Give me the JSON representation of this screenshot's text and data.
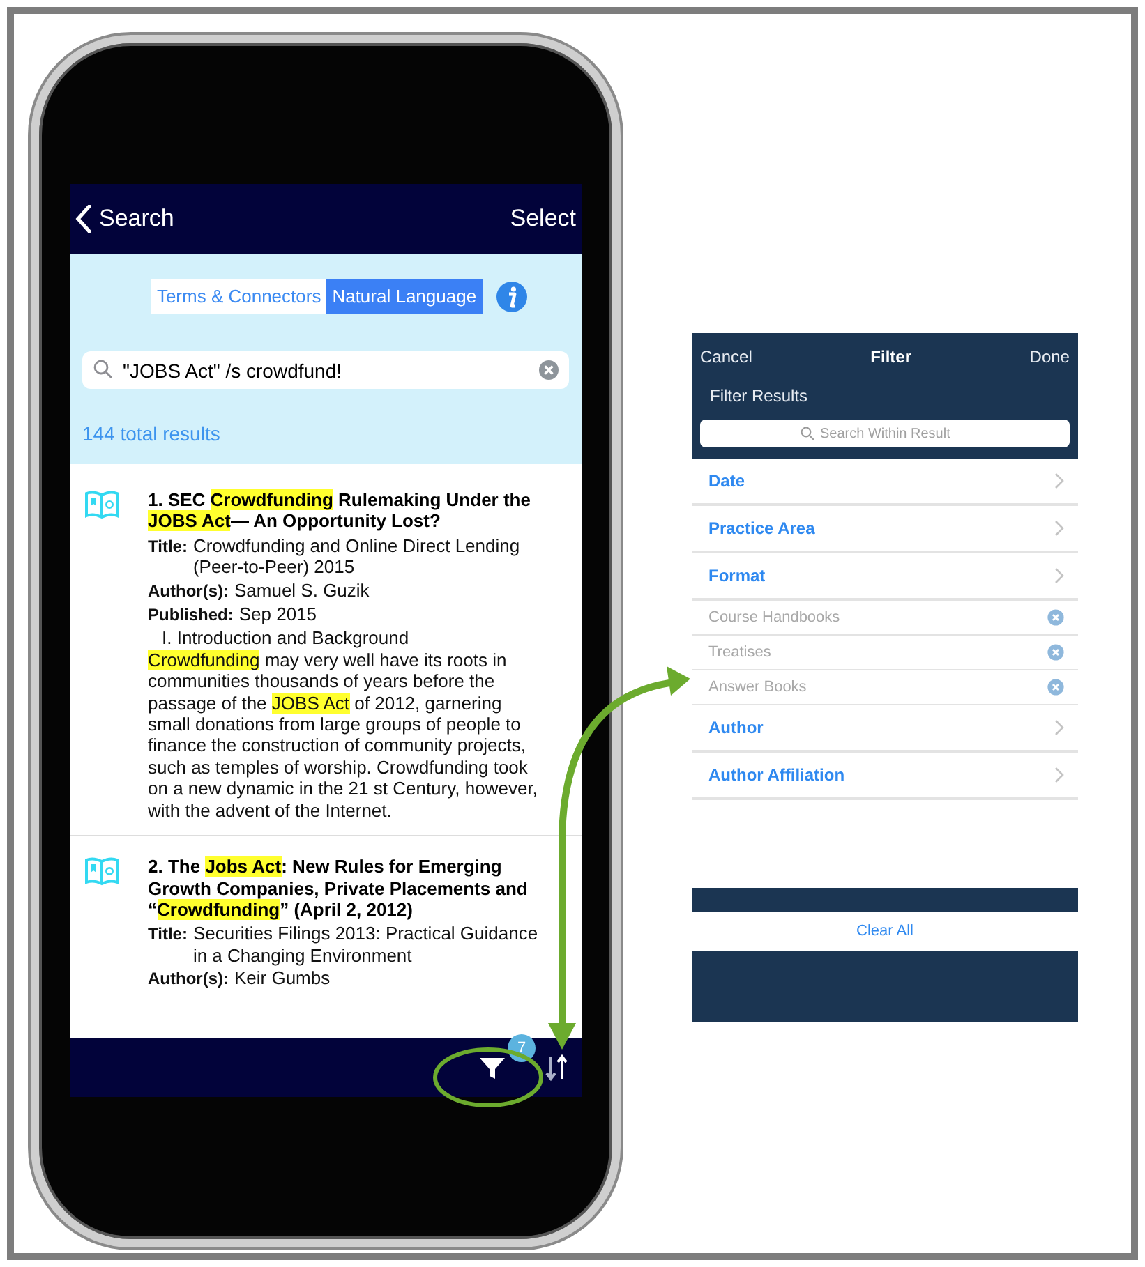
{
  "phone": {
    "nav": {
      "back": "Search",
      "action": "Select"
    },
    "mode_tabs": [
      {
        "label": "Terms & Connectors",
        "selected": false
      },
      {
        "label": "Natural Language",
        "selected": true
      }
    ],
    "search": {
      "value": "\"JOBS Act\" /s crowdfund!"
    },
    "result_count": "144 total results",
    "results": [
      {
        "title": [
          {
            "text": "1. SEC ",
            "highlight": false
          },
          {
            "text": "Crowdfunding",
            "highlight": true
          },
          {
            "text": " Rulemaking Under the ",
            "highlight": false
          },
          {
            "text": "JOBS Act",
            "highlight": true
          },
          {
            "text": "— An Opportunity Lost?",
            "highlight": false
          }
        ],
        "fields": [
          {
            "label": "Title:",
            "value": "Crowdfunding and Online Direct Lending (Peer-to-Peer) 2015"
          },
          {
            "label": "Author(s):",
            "value": "Samuel S. Guzik"
          },
          {
            "label": "Published:",
            "value": "Sep 2015"
          }
        ],
        "snippet_heading": "I. Introduction and Background",
        "snippet": [
          {
            "text": "Crowdfunding",
            "highlight": true
          },
          {
            "text": " may very well have its roots in communities thousands of years before the passage of the ",
            "highlight": false
          },
          {
            "text": "JOBS Act",
            "highlight": true
          },
          {
            "text": " of 2012, garnering small donations from large groups of people to finance the construction of community projects, such as temples of worship. Crowdfunding took on a new dynamic in the 21 st Century, however, with the advent of the Internet.",
            "highlight": false
          }
        ]
      },
      {
        "title": [
          {
            "text": "2. The ",
            "highlight": false
          },
          {
            "text": "Jobs Act",
            "highlight": true
          },
          {
            "text": ": New Rules for Emerging Growth Companies, Private Placements and “",
            "highlight": false
          },
          {
            "text": "Crowdfunding",
            "highlight": true
          },
          {
            "text": "” (April 2, 2012)",
            "highlight": false
          }
        ],
        "fields": [
          {
            "label": "Title:",
            "value": "Securities Filings 2013: Practical Guidance in a Changing Environment"
          },
          {
            "label": "Author(s):",
            "value": "Keir Gumbs"
          }
        ]
      }
    ],
    "toolbar": {
      "filter_count": "7"
    }
  },
  "filter_panel": {
    "cancel": "Cancel",
    "title": "Filter",
    "done": "Done",
    "subtitle": "Filter Results",
    "search": {
      "placeholder": "Search Within Result"
    },
    "rows": [
      {
        "kind": "category",
        "label": "Date"
      },
      {
        "kind": "category",
        "label": "Practice Area"
      },
      {
        "kind": "category",
        "label": "Format"
      },
      {
        "kind": "value",
        "label": "Course Handbooks"
      },
      {
        "kind": "value",
        "label": "Treatises"
      },
      {
        "kind": "value",
        "label": "Answer Books"
      },
      {
        "kind": "category",
        "label": "Author"
      },
      {
        "kind": "category",
        "label": "Author Affiliation"
      }
    ],
    "clear_all": "Clear All"
  }
}
